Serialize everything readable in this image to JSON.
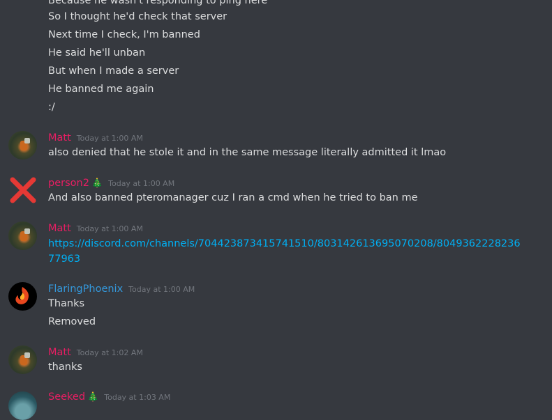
{
  "messages": {
    "prev": {
      "lines": [
        "Because he wasn't responding to ping here",
        "So I thought he'd check that server",
        "Next time I check, I'm banned",
        "He said he'll unban",
        "But when I made a server",
        "He banned me again",
        ":/"
      ]
    },
    "m1": {
      "author": "Matt",
      "timestamp": "Today at 1:00 AM",
      "text": "also denied that he stole it and in the same message literally admitted it lmao"
    },
    "m2": {
      "author": "person2",
      "badge": "🎄",
      "timestamp": "Today at 1:00 AM",
      "text": "And also banned pteromanager cuz I ran a cmd when he tried to ban me"
    },
    "m3": {
      "author": "Matt",
      "timestamp": "Today at 1:00 AM",
      "link": "https://discord.com/channels/704423873415741510/803142613695070208/804936222823677963"
    },
    "m4": {
      "author": "FlaringPhoenix",
      "timestamp": "Today at 1:00 AM",
      "lines": [
        "Thanks",
        "Removed"
      ]
    },
    "m5": {
      "author": "Matt",
      "timestamp": "Today at 1:02 AM",
      "text": "thanks"
    },
    "m6": {
      "author": "Seeked",
      "badge": "🎄",
      "timestamp": "Today at 1:03 AM"
    }
  },
  "colors": {
    "background": "#36393f",
    "text": "#dcddde",
    "role_pink": "#e91e63",
    "role_blue": "#3498db",
    "link": "#00b0f4",
    "timestamp": "#72767d"
  },
  "icons": {
    "person2_avatar": "red-x-icon"
  }
}
